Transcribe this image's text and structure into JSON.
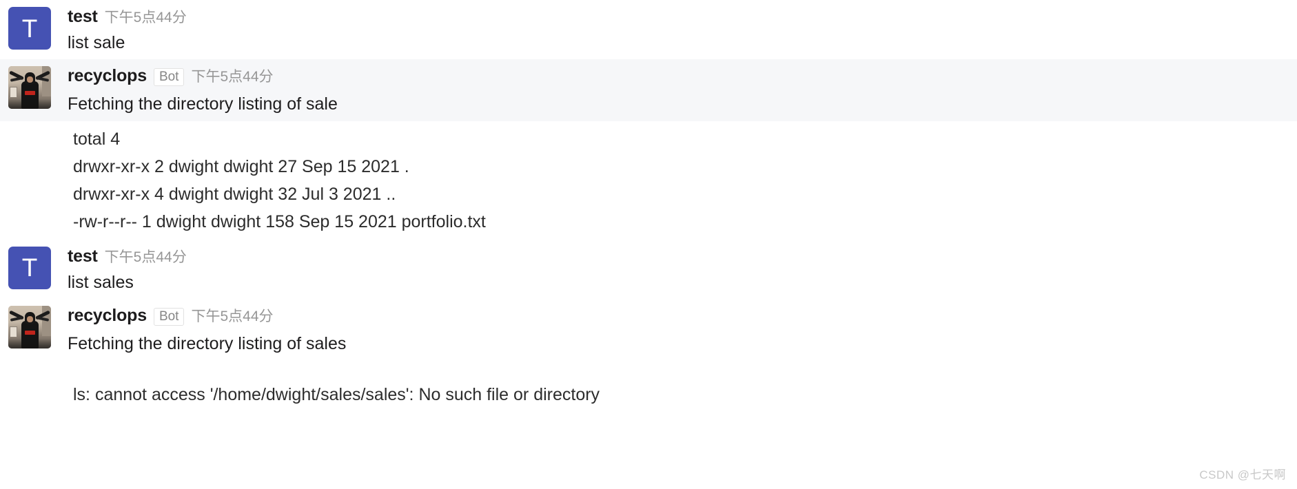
{
  "app": {
    "platform": "slack-chat-transcript",
    "background_color": "#ffffff",
    "highlight_color": "#f6f7f9",
    "accent_color": "#4552b3",
    "text_color": "#1d1c1d",
    "muted_color": "#969696"
  },
  "messages": [
    {
      "id": "m1",
      "type": "user",
      "avatar": {
        "kind": "initial",
        "initial": "T",
        "color": "#4552b3"
      },
      "author": "test",
      "badge": null,
      "timestamp": "下午5点44分",
      "text": "list sale",
      "highlighted": false
    },
    {
      "id": "m2",
      "type": "bot",
      "avatar": {
        "kind": "photo",
        "alt": "recyclops-avatar-photo"
      },
      "author": "recyclops",
      "badge": "Bot",
      "timestamp": "下午5点44分",
      "text": "Fetching the directory listing of sale",
      "highlighted": true
    },
    {
      "id": "m3",
      "type": "user",
      "avatar": {
        "kind": "initial",
        "initial": "T",
        "color": "#4552b3"
      },
      "author": "test",
      "badge": null,
      "timestamp": "下午5点44分",
      "text": "list sales",
      "highlighted": false
    },
    {
      "id": "m4",
      "type": "bot",
      "avatar": {
        "kind": "photo",
        "alt": "recyclops-avatar-photo"
      },
      "author": "recyclops",
      "badge": "Bot",
      "timestamp": "下午5点44分",
      "text": "Fetching the directory listing of sales",
      "highlighted": false
    }
  ],
  "outputs": {
    "listing": {
      "lines": [
        "total 4",
        "drwxr-xr-x 2 dwight dwight 27 Sep 15 2021 .",
        "drwxr-xr-x 4 dwight dwight 32 Jul 3 2021 ..",
        "-rw-r--r-- 1 dwight dwight 158 Sep 15 2021 portfolio.txt"
      ]
    },
    "error": {
      "lines": [
        "ls: cannot access '/home/dwight/sales/sales': No such file or directory"
      ]
    }
  },
  "watermark": {
    "text": "CSDN @七天啊"
  }
}
